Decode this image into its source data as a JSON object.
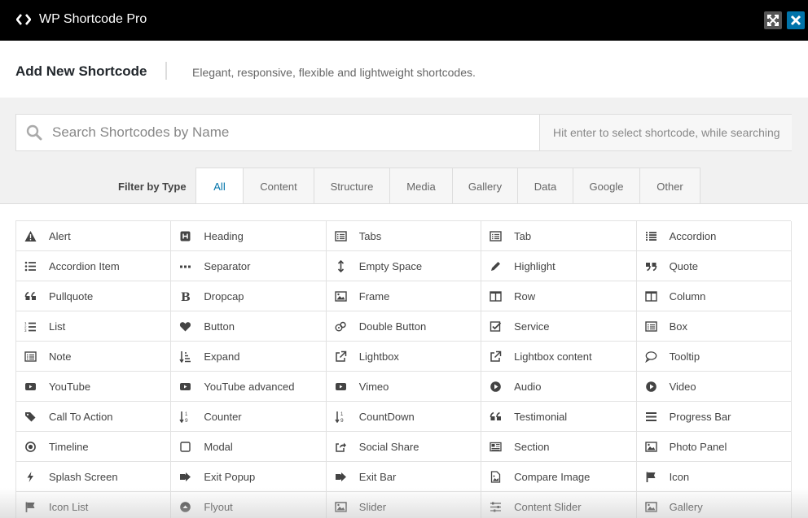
{
  "app": {
    "title": "WP Shortcode Pro"
  },
  "header": {
    "title": "Add New Shortcode",
    "subtitle": "Elegant, responsive, flexible and lightweight shortcodes."
  },
  "search": {
    "placeholder": "Search Shortcodes by Name",
    "value": "",
    "hint": "Hit enter to select shortcode, while searching"
  },
  "filter": {
    "label": "Filter by Type",
    "active": "All",
    "tabs": [
      "All",
      "Content",
      "Structure",
      "Media",
      "Gallery",
      "Data",
      "Google",
      "Other"
    ]
  },
  "colors": {
    "accent": "#0073aa",
    "topbar": "#000000",
    "icon": "#444444"
  },
  "shortcodes": [
    {
      "label": "Alert",
      "icon": "warning-icon"
    },
    {
      "label": "Heading",
      "icon": "heading-icon"
    },
    {
      "label": "Tabs",
      "icon": "list-alt-icon"
    },
    {
      "label": "Tab",
      "icon": "list-alt-icon"
    },
    {
      "label": "Accordion",
      "icon": "list-icon"
    },
    {
      "label": "Accordion Item",
      "icon": "list-ul-icon"
    },
    {
      "label": "Separator",
      "icon": "ellipsis-icon"
    },
    {
      "label": "Empty Space",
      "icon": "arrows-v-icon"
    },
    {
      "label": "Highlight",
      "icon": "pencil-icon"
    },
    {
      "label": "Quote",
      "icon": "quote-right-icon"
    },
    {
      "label": "Pullquote",
      "icon": "quote-left-icon"
    },
    {
      "label": "Dropcap",
      "icon": "bold-icon"
    },
    {
      "label": "Frame",
      "icon": "image-icon"
    },
    {
      "label": "Row",
      "icon": "columns-icon"
    },
    {
      "label": "Column",
      "icon": "columns-icon"
    },
    {
      "label": "List",
      "icon": "list-ol-icon"
    },
    {
      "label": "Button",
      "icon": "heart-icon"
    },
    {
      "label": "Double Button",
      "icon": "double-button-icon"
    },
    {
      "label": "Service",
      "icon": "check-square-icon"
    },
    {
      "label": "Box",
      "icon": "list-alt-icon"
    },
    {
      "label": "Note",
      "icon": "list-alt-icon"
    },
    {
      "label": "Expand",
      "icon": "sort-amount-icon"
    },
    {
      "label": "Lightbox",
      "icon": "external-link-icon"
    },
    {
      "label": "Lightbox content",
      "icon": "external-link-icon"
    },
    {
      "label": "Tooltip",
      "icon": "comment-icon"
    },
    {
      "label": "YouTube",
      "icon": "youtube-icon"
    },
    {
      "label": "YouTube advanced",
      "icon": "youtube-icon"
    },
    {
      "label": "Vimeo",
      "icon": "youtube-icon"
    },
    {
      "label": "Audio",
      "icon": "play-circle-icon"
    },
    {
      "label": "Video",
      "icon": "play-circle-icon"
    },
    {
      "label": "Call To Action",
      "icon": "tags-icon"
    },
    {
      "label": "Counter",
      "icon": "sort-numeric-icon"
    },
    {
      "label": "CountDown",
      "icon": "sort-numeric-icon"
    },
    {
      "label": "Testimonial",
      "icon": "quote-left-icon"
    },
    {
      "label": "Progress Bar",
      "icon": "bars-icon"
    },
    {
      "label": "Timeline",
      "icon": "dot-circle-icon"
    },
    {
      "label": "Modal",
      "icon": "square-icon"
    },
    {
      "label": "Social Share",
      "icon": "share-icon"
    },
    {
      "label": "Section",
      "icon": "newspaper-icon"
    },
    {
      "label": "Photo Panel",
      "icon": "image-icon"
    },
    {
      "label": "Splash Screen",
      "icon": "bolt-icon"
    },
    {
      "label": "Exit Popup",
      "icon": "sign-out-icon"
    },
    {
      "label": "Exit Bar",
      "icon": "sign-out-icon"
    },
    {
      "label": "Compare Image",
      "icon": "file-image-icon"
    },
    {
      "label": "Icon",
      "icon": "flag-icon"
    },
    {
      "label": "Icon List",
      "icon": "flag-icon"
    },
    {
      "label": "Flyout",
      "icon": "arrow-circle-up-icon"
    },
    {
      "label": "Slider",
      "icon": "image-icon"
    },
    {
      "label": "Content Slider",
      "icon": "sliders-icon"
    },
    {
      "label": "Gallery",
      "icon": "image-icon"
    }
  ]
}
